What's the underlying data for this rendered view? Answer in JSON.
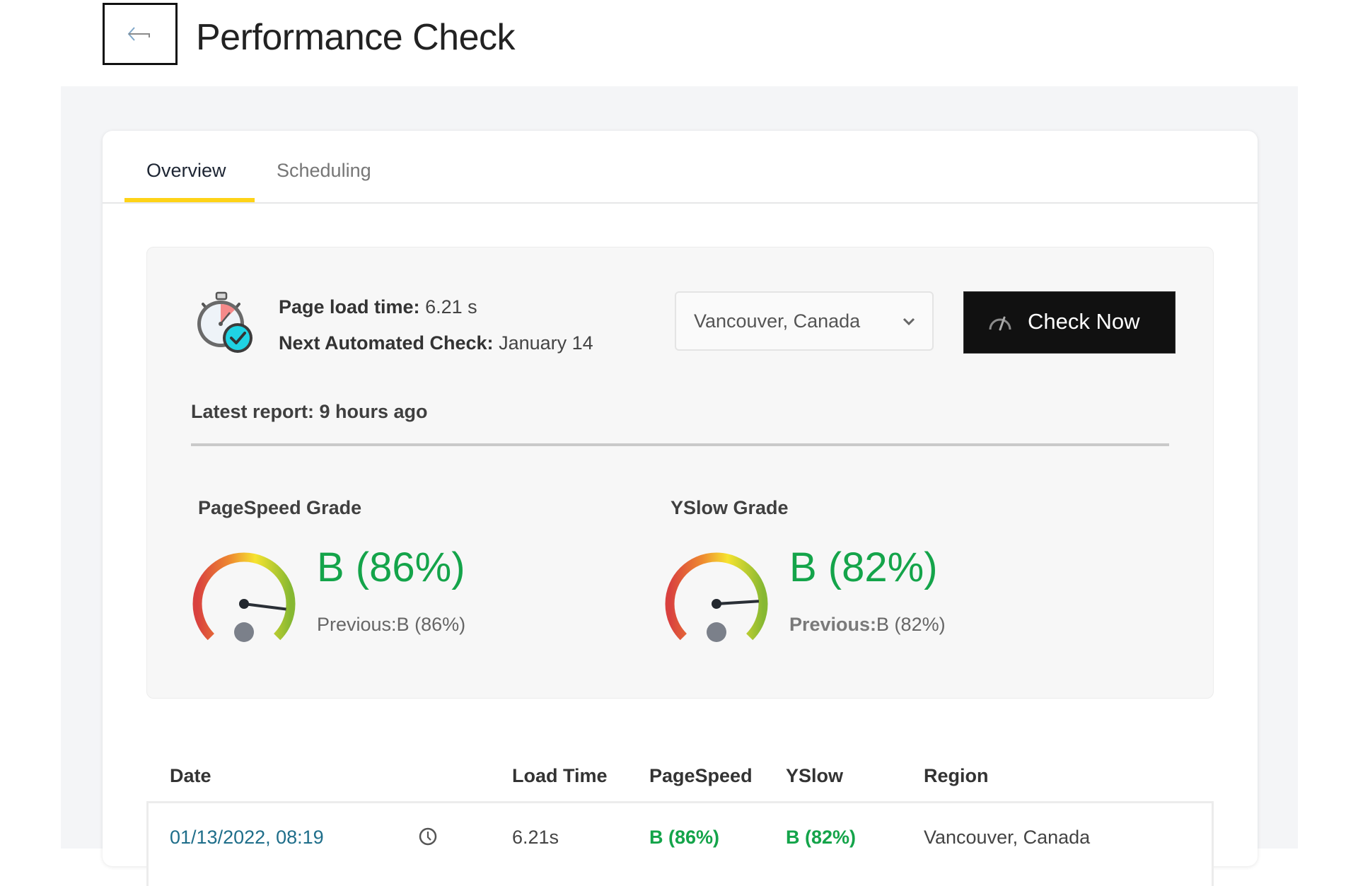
{
  "header": {
    "title": "Performance Check",
    "back_icon": "arrow-left-icon"
  },
  "tabs": [
    {
      "label": "Overview",
      "active": true
    },
    {
      "label": "Scheduling",
      "active": false
    }
  ],
  "accent_color": "#fed317",
  "summary": {
    "icon": "stopwatch-check-icon",
    "page_load_label": "Page load time:",
    "page_load_value": "6.21 s",
    "next_check_label": "Next Automated Check:",
    "next_check_value": "January 14",
    "region_select": {
      "selected": "Vancouver, Canada",
      "icon": "chevron-down-icon"
    },
    "check_button": {
      "label": "Check Now",
      "icon": "speedometer-icon"
    },
    "latest_report": "Latest report: 9 hours ago"
  },
  "grades": {
    "pagespeed": {
      "title": "PageSpeed Grade",
      "value": "B (86%)",
      "percent": 86,
      "previous_label": "Previous:",
      "previous_value": "B (86%)",
      "color": "#14a44a"
    },
    "yslow": {
      "title": "YSlow Grade",
      "value": "B (82%)",
      "percent": 82,
      "previous_label": "Previous:",
      "previous_value": "B (82%)",
      "color": "#14a44a"
    }
  },
  "table": {
    "columns": [
      "Date",
      "Load Time",
      "PageSpeed",
      "YSlow",
      "Region"
    ],
    "rows": [
      {
        "date": "01/13/2022, 08:19",
        "icon": "clock-icon",
        "load_time": "6.21s",
        "pagespeed": "B (86%)",
        "yslow": "B (82%)",
        "region": "Vancouver, Canada"
      }
    ]
  }
}
